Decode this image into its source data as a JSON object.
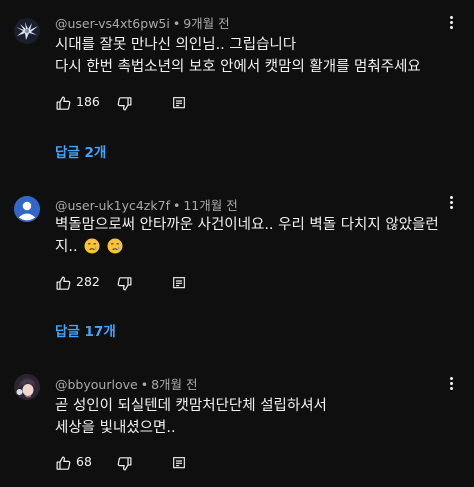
{
  "comments": [
    {
      "handle": "@user-vs4xt6pw5i",
      "separator": "•",
      "time": "9개월 전",
      "lines": [
        "시대를 잘못 만나신 의인님.. 그립습니다",
        "다시 한번 촉법소년의 보호 안에서 캣맘의 활개를 멈춰주세요"
      ],
      "likes": "186",
      "replies_label": "답글 2개",
      "avatar_icon": "winged-figure-avatar"
    },
    {
      "handle": "@user-uk1yc4zk7f",
      "separator": "•",
      "time": "11개월 전",
      "lines": [
        "벽돌맘으로써 안타까운 사건이네요.. 우리 벽돌 다치지 않았을런",
        "지.."
      ],
      "emojis": [
        "crying-face-emoji",
        "crying-face-emoji"
      ],
      "likes": "282",
      "replies_label": "답글 17개",
      "avatar_icon": "default-person-avatar"
    },
    {
      "handle": "@bbyourlove",
      "separator": "•",
      "time": "8개월 전",
      "lines": [
        "곧 성인이 되실텐데 캣맘처단단체 설립하셔서",
        "세상을 빛내셨으면.."
      ],
      "likes": "68",
      "avatar_icon": "anime-character-avatar"
    }
  ],
  "colors": {
    "background": "#0f0f0f",
    "text": "#f1f1f1",
    "secondary_text": "#aaaaaa",
    "link_blue": "#3ea6ff",
    "default_avatar_blue": "#3466c8"
  }
}
